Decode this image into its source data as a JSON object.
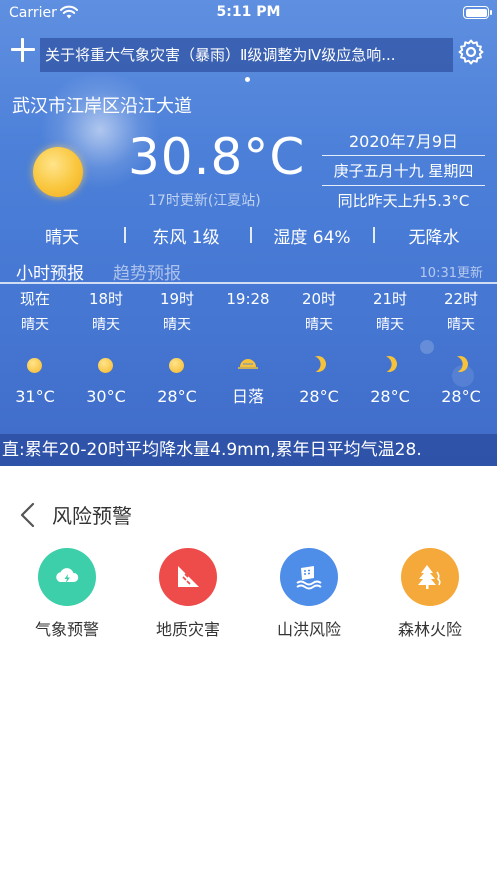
{
  "status_bar": {
    "carrier": "Carrier",
    "time": "5:11 PM"
  },
  "marquee": {
    "text": "关于将重大气象灾害（暴雨）Ⅱ级调整为Ⅳ级应急响..."
  },
  "location": "武汉市江岸区沿江大道",
  "current": {
    "temperature": "30.8°C",
    "update": "17时更新(江夏站)",
    "icon": "sun-icon"
  },
  "date": {
    "gregorian": "2020年7月9日",
    "lunar": "庚子五月十九 星期四",
    "compare": "同比昨天上升5.3°C"
  },
  "conditions": [
    {
      "label": "晴天"
    },
    {
      "label": "东风 1级"
    },
    {
      "label": "湿度 64%"
    },
    {
      "label": "无降水"
    }
  ],
  "forecast_tabs": {
    "hourly": "小时预报",
    "trend": "趋势预报",
    "updated": "10:31更新"
  },
  "hourly": [
    {
      "time": "现在",
      "cond": "晴天",
      "icon": "sun",
      "temp": "31°C"
    },
    {
      "time": "18时",
      "cond": "晴天",
      "icon": "sun",
      "temp": "30°C"
    },
    {
      "time": "19时",
      "cond": "晴天",
      "icon": "sun",
      "temp": "28°C"
    },
    {
      "time": "19:28",
      "cond": "",
      "icon": "sunset",
      "temp": "日落"
    },
    {
      "time": "20时",
      "cond": "晴天",
      "icon": "moon",
      "temp": "28°C"
    },
    {
      "time": "21时",
      "cond": "晴天",
      "icon": "moon",
      "temp": "28°C"
    },
    {
      "time": "22时",
      "cond": "晴天",
      "icon": "moon",
      "temp": "28°C"
    }
  ],
  "ticker": {
    "text": "直:累年20-20时平均降水量4.9mm,累年日平均气温28."
  },
  "risk": {
    "title": "风险预警",
    "items": [
      {
        "label": "气象预警",
        "color": "#3ccfa9",
        "icon": "weather-alert-icon"
      },
      {
        "label": "地质灾害",
        "color": "#ee4b4b",
        "icon": "landslide-icon"
      },
      {
        "label": "山洪风险",
        "color": "#4f8ee8",
        "icon": "flood-icon"
      },
      {
        "label": "森林火险",
        "color": "#f5a93a",
        "icon": "forest-fire-icon"
      }
    ]
  }
}
